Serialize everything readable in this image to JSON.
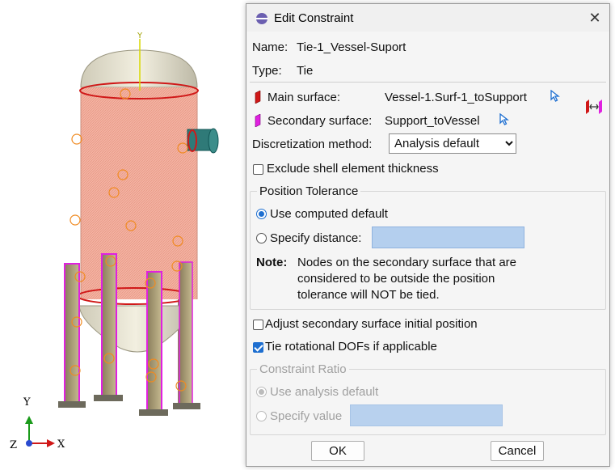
{
  "viewport": {
    "model_axis_label": "Y",
    "triad": {
      "y_label": "Y",
      "x_label": "X",
      "z_label": "Z"
    }
  },
  "dialog": {
    "title": "Edit Constraint",
    "close_glyph": "✕",
    "name_label": "Name:",
    "name_value": "Tie-1_Vessel-Suport",
    "type_label": "Type:",
    "type_value": "Tie",
    "main_surface_label": "Main surface:",
    "main_surface_value": "Vessel-1.Surf-1_toSupport",
    "secondary_surface_label": "Secondary surface:",
    "secondary_surface_value": "Support_toVessel",
    "discretization_label": "Discretization method:",
    "discretization_value": "Analysis default",
    "exclude_shell_label": "Exclude shell element thickness",
    "exclude_shell_checked": false,
    "position_tolerance": {
      "title": "Position Tolerance",
      "use_computed_label": "Use computed default",
      "specify_distance_label": "Specify distance:",
      "specify_distance_value": "",
      "selected": "use_computed",
      "note_label": "Note:",
      "note_text": "Nodes on the secondary surface that are considered to be outside the position tolerance will NOT be tied."
    },
    "adjust_label": "Adjust secondary surface initial position",
    "adjust_checked": false,
    "tie_rot_label": "Tie rotational DOFs if applicable",
    "tie_rot_checked": true,
    "constraint_ratio": {
      "title": "Constraint Ratio",
      "use_analysis_label": "Use analysis default",
      "specify_value_label": "Specify value",
      "specify_value_value": "",
      "selected": "use_analysis",
      "enabled": false
    },
    "ok_label": "OK",
    "cancel_label": "Cancel"
  },
  "colors": {
    "accent": "#1e6fd0",
    "vessel_surface": "#f0a898",
    "main_surface_marker": "#d01818",
    "secondary_surface_marker": "#e020e0",
    "field_fill": "#b4cfee"
  }
}
